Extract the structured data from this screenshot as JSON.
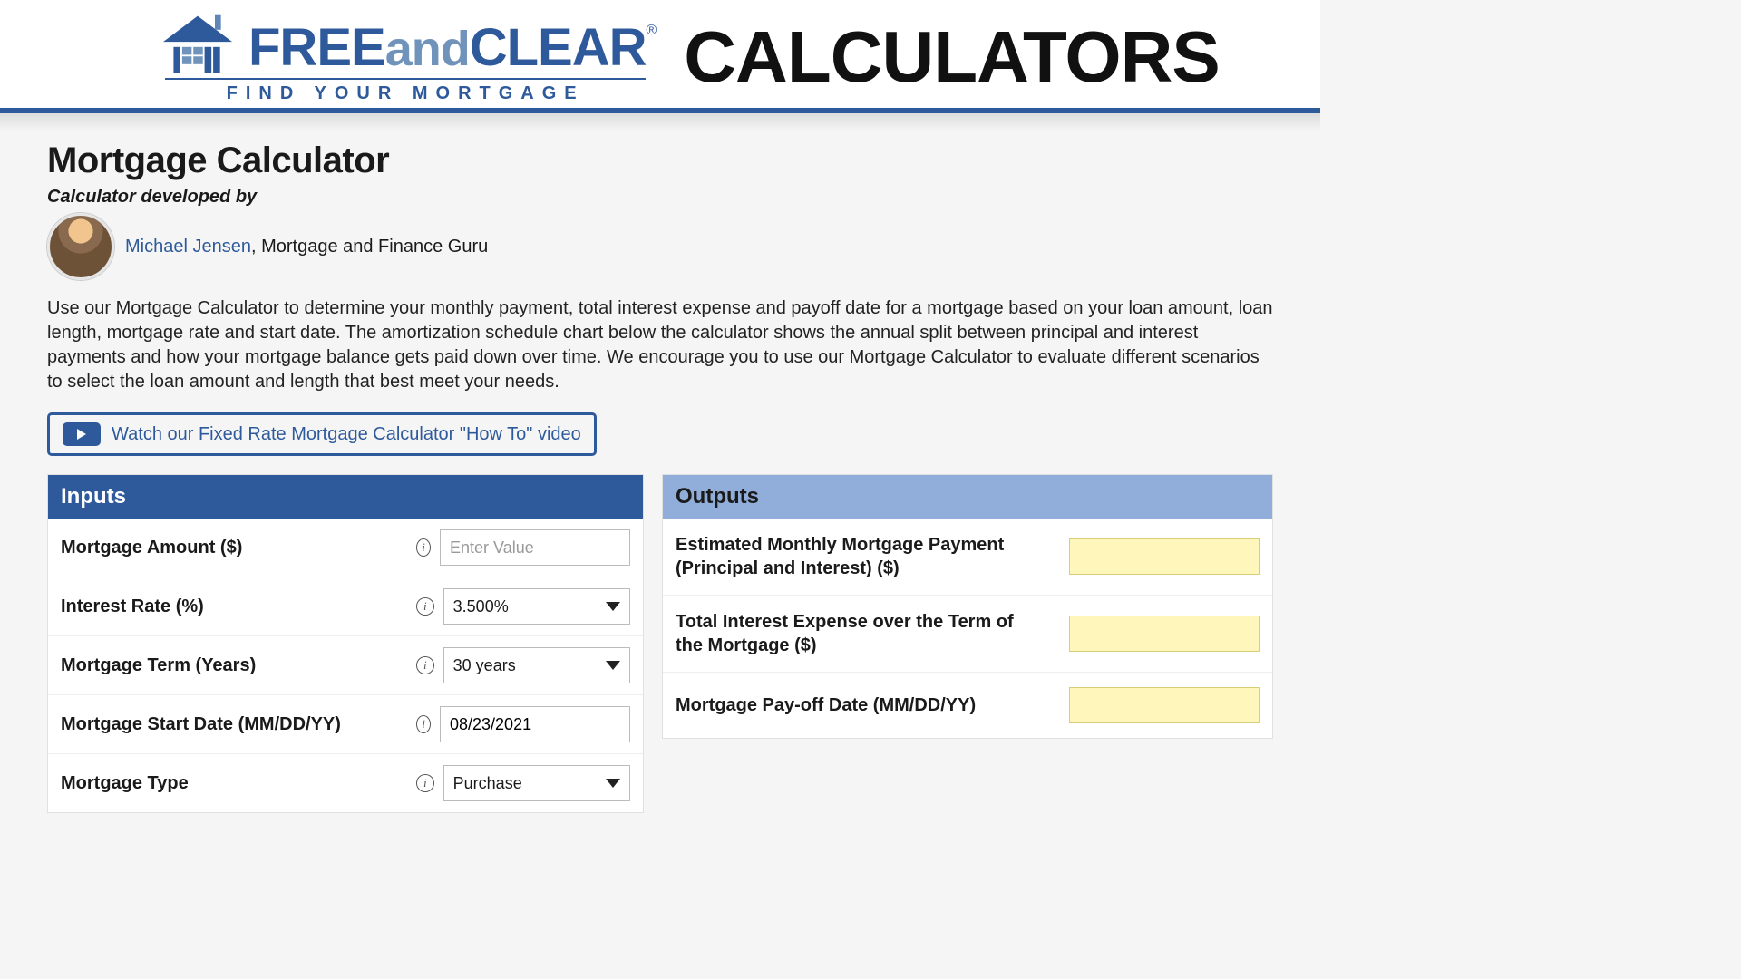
{
  "header": {
    "brand": {
      "free": "FREE",
      "and": "and",
      "clear": "CLEAR",
      "reg": "®"
    },
    "tagline": "FIND YOUR MORTGAGE",
    "calculators": "CALCULATORS"
  },
  "page": {
    "title": "Mortgage Calculator",
    "developed_by": "Calculator developed by",
    "author_name": "Michael Jensen",
    "author_title": ", Mortgage and Finance Guru",
    "intro": "Use our Mortgage Calculator to determine your monthly payment, total interest expense and payoff date for a mortgage based on your loan amount, loan length, mortgage rate and start date. The amortization schedule chart below the calculator shows the annual split between principal and interest payments and how your mortgage balance gets paid down over time. We encourage you to use our Mortgage Calculator to evaluate different scenarios to select the loan amount and length that best meet your needs.",
    "video_link": "Watch our Fixed Rate Mortgage Calculator \"How To\" video"
  },
  "inputs": {
    "heading": "Inputs",
    "mortgage_amount": {
      "label": "Mortgage Amount ($)",
      "placeholder": "Enter Value",
      "value": ""
    },
    "interest_rate": {
      "label": "Interest Rate (%)",
      "value": "3.500%"
    },
    "mortgage_term": {
      "label": "Mortgage Term (Years)",
      "value": "30 years"
    },
    "start_date": {
      "label": "Mortgage Start Date (MM/DD/YY)",
      "value": "08/23/2021"
    },
    "mortgage_type": {
      "label": "Mortgage Type",
      "value": "Purchase"
    }
  },
  "outputs": {
    "heading": "Outputs",
    "monthly_payment": {
      "label": "Estimated Monthly Mortgage Payment (Principal and Interest) ($)",
      "value": ""
    },
    "total_interest": {
      "label": "Total Interest Expense over the Term of the Mortgage  ($)",
      "value": ""
    },
    "payoff_date": {
      "label": "Mortgage Pay-off Date (MM/DD/YY)",
      "value": ""
    }
  },
  "info_glyph": "i"
}
